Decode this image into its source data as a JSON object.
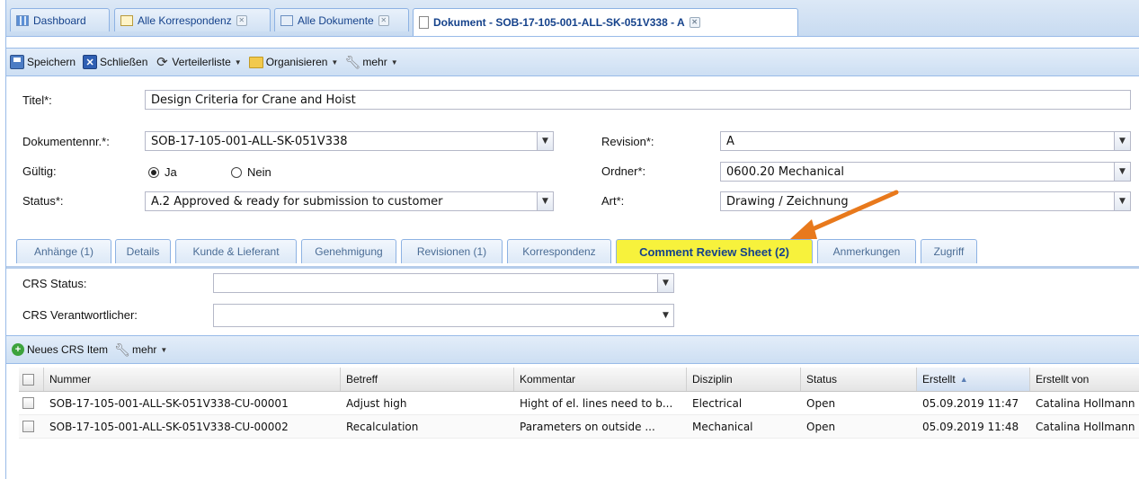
{
  "tabs": [
    {
      "label": "Dashboard",
      "icon": "dashboard-icon"
    },
    {
      "label": "Alle Korrespondenz",
      "icon": "mail-icon"
    },
    {
      "label": "Alle Dokumente",
      "icon": "documents-icon"
    },
    {
      "label": "Dokument - SOB-17-105-001-ALL-SK-051V338 - A",
      "icon": "document-icon"
    }
  ],
  "toolbar": {
    "save": "Speichern",
    "close": "Schließen",
    "distribution": "Verteilerliste",
    "organize": "Organisieren",
    "more": "mehr"
  },
  "form": {
    "title_label": "Titel*:",
    "title_value": "Design Criteria for Crane and Hoist",
    "docnr_label": "Dokumentennr.*:",
    "docnr_value": "SOB-17-105-001-ALL-SK-051V338",
    "valid_label": "Gültig:",
    "valid_yes": "Ja",
    "valid_no": "Nein",
    "status_label": "Status*:",
    "status_value": "A.2 Approved & ready for submission to customer",
    "revision_label": "Revision*:",
    "revision_value": "A",
    "folder_label": "Ordner*:",
    "folder_value": "0600.20 Mechanical",
    "type_label": "Art*:",
    "type_value": "Drawing / Zeichnung"
  },
  "subtabs": [
    "Anhänge (1)",
    "Details",
    "Kunde & Lieferant",
    "Genehmigung",
    "Revisionen (1)",
    "Korrespondenz",
    "Comment Review Sheet (2)",
    "Anmerkungen",
    "Zugriff"
  ],
  "crs": {
    "status_label": "CRS Status:",
    "status_value": "",
    "owner_label": "CRS Verantwortlicher:",
    "owner_value": ""
  },
  "grid_toolbar": {
    "new_item": "Neues CRS Item",
    "more": "mehr"
  },
  "grid": {
    "columns": [
      "Nummer",
      "Betreff",
      "Kommentar",
      "Disziplin",
      "Status",
      "Erstellt",
      "Erstellt von"
    ],
    "rows": [
      [
        "SOB-17-105-001-ALL-SK-051V338-CU-00001",
        "Adjust high",
        "Hight of el. lines need to b...",
        "Electrical",
        "Open",
        "05.09.2019 11:47",
        "Catalina Hollmann"
      ],
      [
        "SOB-17-105-001-ALL-SK-051V338-CU-00002",
        "Recalculation",
        "Parameters on outside ...",
        "Mechanical",
        "Open",
        "05.09.2019 11:48",
        "Catalina Hollmann"
      ]
    ]
  },
  "colors": {
    "highlight_tab": "#f7f23c",
    "annotation_arrow": "#e8791c",
    "header_blue": "#15428b"
  }
}
